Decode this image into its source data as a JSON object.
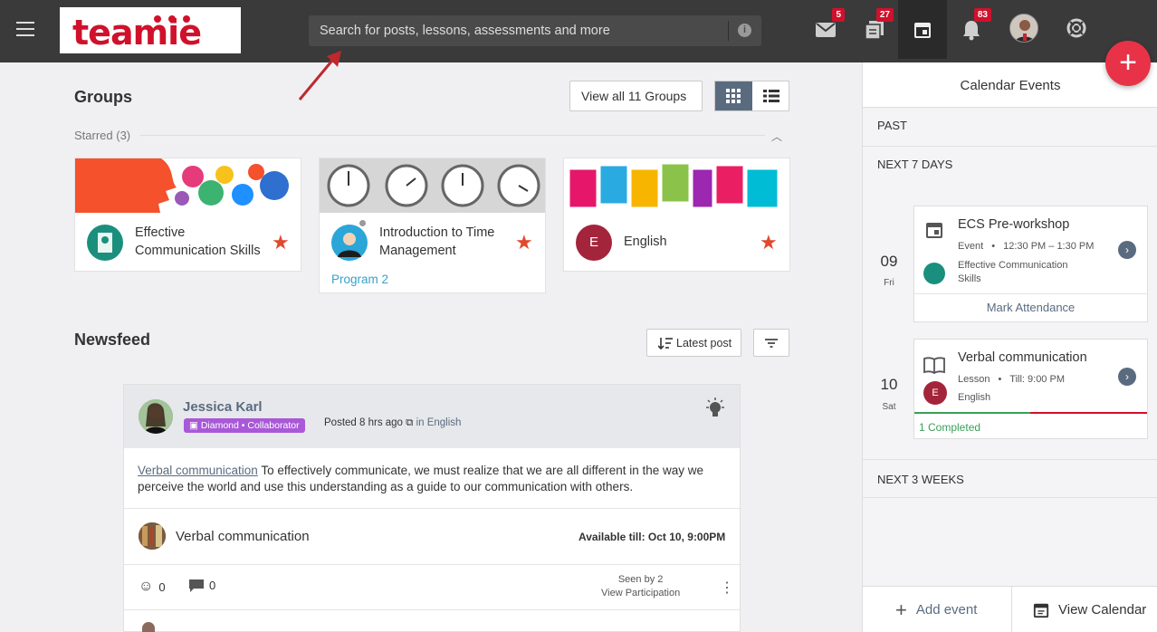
{
  "header": {
    "logo_text": "teamie",
    "search_placeholder": "Search for posts, lessons, assessments and more",
    "messages_badge": "5",
    "gradebook_badge": "27",
    "notifications_badge": "83"
  },
  "groups": {
    "title": "Groups",
    "view_all_label": "View all 11 Groups",
    "starred_label": "Starred (3)",
    "cards": [
      {
        "title_line1": "Effective",
        "title_line2": "Communication Skills",
        "subtitle": ""
      },
      {
        "title_line1": "Introduction to Time",
        "title_line2": "Management",
        "subtitle": "Program 2"
      },
      {
        "title_line1": "English",
        "title_line2": "",
        "subtitle": "",
        "avatar_letter": "E"
      }
    ]
  },
  "newsfeed": {
    "title": "Newsfeed",
    "sort_label": "Latest post",
    "post": {
      "author": "Jessica Karl",
      "tag": "Diamond • Collaborator",
      "posted": "Posted 8 hrs ago",
      "in_label": "in",
      "group": "English",
      "link_text": "Verbal communication",
      "body": " To effectively communicate, we must realize that we are all different in the way we perceive the world and use this understanding as a guide to our communication with others.",
      "attachment_name": "Verbal communication",
      "available_till": "Available till: Oct 10, 9:00PM",
      "reactions_count": "0",
      "comments_count": "0",
      "seen_by": "Seen by 2",
      "view_participation": "View Participation"
    }
  },
  "calendar": {
    "title": "Calendar Events",
    "past": "PAST",
    "next7": "NEXT 7 DAYS",
    "next3w": "NEXT 3 WEEKS",
    "events": [
      {
        "day_num": "09",
        "day_name": "Fri",
        "title": "ECS Pre-workshop",
        "type": "Event",
        "time": "12:30 PM – 1:30 PM",
        "group_line1": "Effective Communication",
        "group_line2": "Skills",
        "action": "Mark Attendance"
      },
      {
        "day_num": "10",
        "day_name": "Sat",
        "title": "Verbal communication",
        "type": "Lesson",
        "time": "Till: 9:00 PM",
        "group_line1": "English",
        "avatar_letter": "E",
        "completed": "1 Completed"
      }
    ],
    "add_event": "Add event",
    "view_calendar": "View Calendar"
  },
  "colors": {
    "brand": "#d0112b",
    "accent": "#5a6b80",
    "fab": "#e83248",
    "star": "#e04a2c"
  }
}
